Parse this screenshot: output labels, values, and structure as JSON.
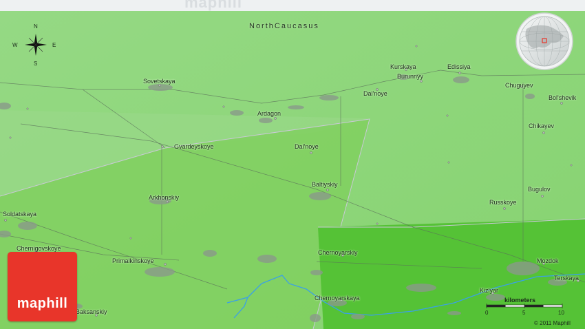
{
  "map": {
    "region_label": "NorthCaucasus",
    "watermark": "maphill",
    "logo_text": "maphill",
    "copyright": "© 2011 Maphill",
    "colors": {
      "plain": "#8fd67d",
      "highlight": "#7fcf5c",
      "dark_green": "#55c236",
      "water": "#3aa0e8",
      "logo": "#e8352a"
    }
  },
  "compass": {
    "north": "N",
    "south": "S",
    "east": "E",
    "west": "W"
  },
  "scale": {
    "title": "kilometers",
    "ticks": [
      "0",
      "5",
      "10"
    ]
  },
  "places": [
    {
      "name": "Sovetskaya"
    },
    {
      "name": "Ardagon"
    },
    {
      "name": "Dal'noye"
    },
    {
      "name": "Kurskaya"
    },
    {
      "name": "Burunnyy"
    },
    {
      "name": "Edissiya"
    },
    {
      "name": "Chuguyev"
    },
    {
      "name": "Bol'shevik"
    },
    {
      "name": "Chikayev"
    },
    {
      "name": "Gvardeyskoye"
    },
    {
      "name": "Dal'noye"
    },
    {
      "name": "Baltiyskiy"
    },
    {
      "name": "Arkhonskiy"
    },
    {
      "name": "Soldatskaya"
    },
    {
      "name": "Bugulov"
    },
    {
      "name": "Russkoye"
    },
    {
      "name": "Chernigovskoye"
    },
    {
      "name": "Primalkinskoye"
    },
    {
      "name": "Chernoyarskiy"
    },
    {
      "name": "Mozdok"
    },
    {
      "name": "Terskaya"
    },
    {
      "name": "Kizlyar"
    },
    {
      "name": "Chernoyarskaya"
    },
    {
      "name": "Baksanskiy"
    }
  ]
}
